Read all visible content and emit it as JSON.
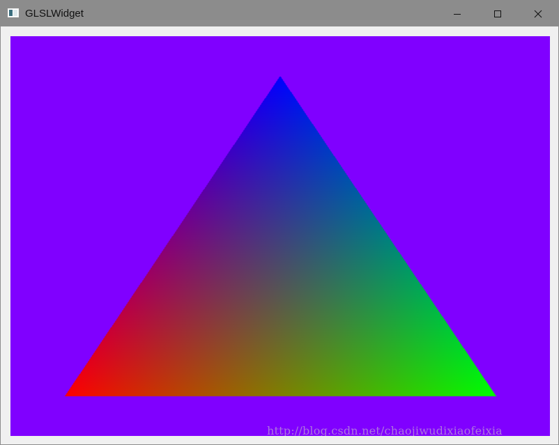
{
  "window": {
    "title": "GLSLWidget",
    "icon": "qt-window-icon",
    "titlebar_color": "#8c8c8c",
    "frame_color": "#f0f0f0"
  },
  "caption_buttons": {
    "minimize_icon": "minimize-icon",
    "maximize_icon": "maximize-icon",
    "close_icon": "close-icon"
  },
  "canvas": {
    "clear_color": "#8000ff",
    "triangle": {
      "vertex_colors": {
        "top": "#0000ff",
        "bottom_left": "#ff0000",
        "bottom_right": "#00ff00"
      }
    }
  },
  "watermark": {
    "text": "http://blog.csdn.net/chaojiwudixiaofeixia"
  }
}
